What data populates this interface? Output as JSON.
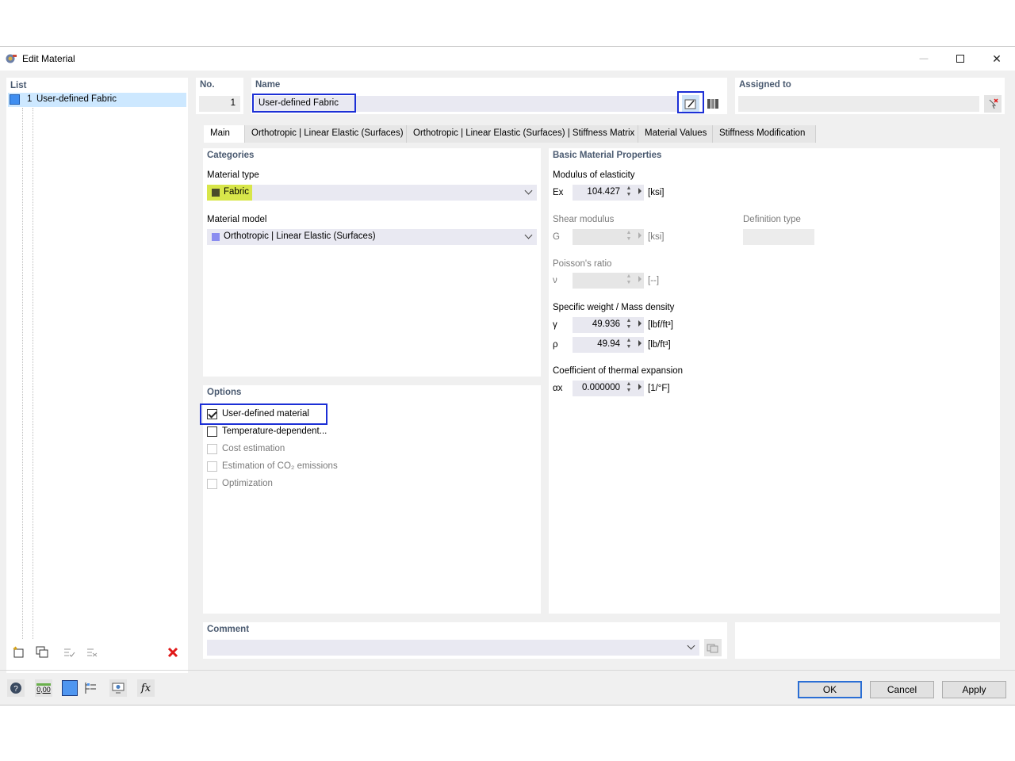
{
  "window": {
    "title": "Edit Material",
    "minimize_glyph": "—",
    "maximize_glyph": "☐",
    "close_glyph": "✕"
  },
  "list": {
    "header": "List",
    "items": [
      {
        "number": "1",
        "label": "User-defined Fabric",
        "color": "#3f8ef0"
      }
    ]
  },
  "no": {
    "label": "No.",
    "value": "1"
  },
  "name": {
    "label": "Name",
    "value": "User-defined Fabric"
  },
  "assigned": {
    "label": "Assigned to",
    "value": ""
  },
  "tabs": [
    {
      "label": "Main",
      "active": true
    },
    {
      "label": "Orthotropic | Linear Elastic (Surfaces)"
    },
    {
      "label": "Orthotropic | Linear Elastic (Surfaces) | Stiffness Matrix"
    },
    {
      "label": "Material Values"
    },
    {
      "label": "Stiffness Modification"
    }
  ],
  "categories": {
    "header": "Categories",
    "material_type_label": "Material type",
    "material_type_value": "Fabric",
    "material_type_color": "#4a4a2a",
    "material_type_highlight": "#d8e64a",
    "material_model_label": "Material model",
    "material_model_value": "Orthotropic | Linear Elastic (Surfaces)",
    "material_model_color": "#8a8cf0"
  },
  "options": {
    "header": "Options",
    "items": [
      {
        "label": "User-defined material",
        "checked": true,
        "enabled": true
      },
      {
        "label": "Temperature-dependent...",
        "checked": false,
        "enabled": true
      },
      {
        "label": "Cost estimation",
        "checked": false,
        "enabled": false
      },
      {
        "label": "Estimation of CO₂ emissions",
        "checked": false,
        "enabled": false
      },
      {
        "label": "Optimization",
        "checked": false,
        "enabled": false
      }
    ]
  },
  "properties": {
    "header": "Basic Material Properties",
    "elasticity_label": "Modulus of elasticity",
    "ex_symbol": "Ex",
    "ex_value": "104.427",
    "ex_unit": "[ksi]",
    "shear_label": "Shear modulus",
    "g_symbol": "G",
    "g_value": "",
    "g_unit": "[ksi]",
    "definition_type_label": "Definition type",
    "definition_type_value": "",
    "poisson_label": "Poisson's ratio",
    "nu_symbol": "ν",
    "nu_value": "",
    "nu_unit": "[--]",
    "weight_label": "Specific weight / Mass density",
    "gamma_symbol": "γ",
    "gamma_value": "49.936",
    "gamma_unit": "[lbf/ft³]",
    "rho_symbol": "ρ",
    "rho_value": "49.94",
    "rho_unit": "[lb/ft³]",
    "thermal_label": "Coefficient of thermal expansion",
    "alpha_symbol": "αx",
    "alpha_value": "0.000000",
    "alpha_unit": "[1/°F]"
  },
  "comment": {
    "label": "Comment",
    "value": ""
  },
  "buttons": {
    "ok": "OK",
    "cancel": "Cancel",
    "apply": "Apply"
  },
  "footer_icons": [
    "help-icon",
    "units-icon",
    "color-icon",
    "display-icon",
    "view-icon",
    "formula-icon"
  ],
  "footer_units_text": "0,00",
  "footer_formula_text": "f𝑥"
}
